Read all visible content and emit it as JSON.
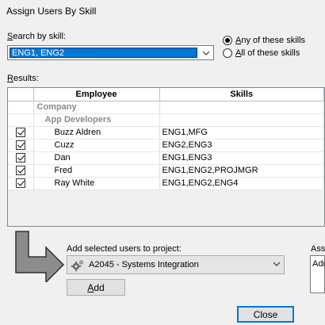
{
  "window": {
    "title": "Assign Users By Skill"
  },
  "search": {
    "label": "Search by skill:",
    "label_accel": "S",
    "label_rest": "earch by skill:",
    "value": "ENG1, ENG2"
  },
  "match_mode": {
    "any_prefix": "",
    "any_accel": "A",
    "any_rest": "ny of these skills",
    "any_label": "Any of these skills",
    "all_accel": "A",
    "all_rest": "ll of these skills",
    "all_label": "All of these skills",
    "selected": "any"
  },
  "results": {
    "label_accel": "R",
    "label_rest": "esults:",
    "columns": {
      "employee": "Employee",
      "skills": "Skills"
    },
    "groups": {
      "company": "Company",
      "team": "App Developers"
    },
    "rows": [
      {
        "name": "Buzz Aldren",
        "skills": "ENG1,MFG",
        "checked": true
      },
      {
        "name": "Cuzz",
        "skills": "ENG2,ENG3",
        "checked": true
      },
      {
        "name": "Dan",
        "skills": "ENG1,ENG3",
        "checked": true
      },
      {
        "name": "Fred",
        "skills": "ENG1,ENG2,PROJMGR",
        "checked": true
      },
      {
        "name": "Ray White",
        "skills": "ENG1,ENG2,ENG4",
        "checked": true
      }
    ]
  },
  "project": {
    "label": "Add selected users to project:",
    "value": "A2045 - Systems Integration",
    "icon": "gear-icon",
    "add_accel": "A",
    "add_rest": "dd"
  },
  "right_panel": {
    "label": "Ass",
    "box_text": "Adr"
  },
  "footer": {
    "close_label": "Close"
  },
  "colors": {
    "selection": "#0078d7",
    "arrow": "#8c8c8c"
  }
}
